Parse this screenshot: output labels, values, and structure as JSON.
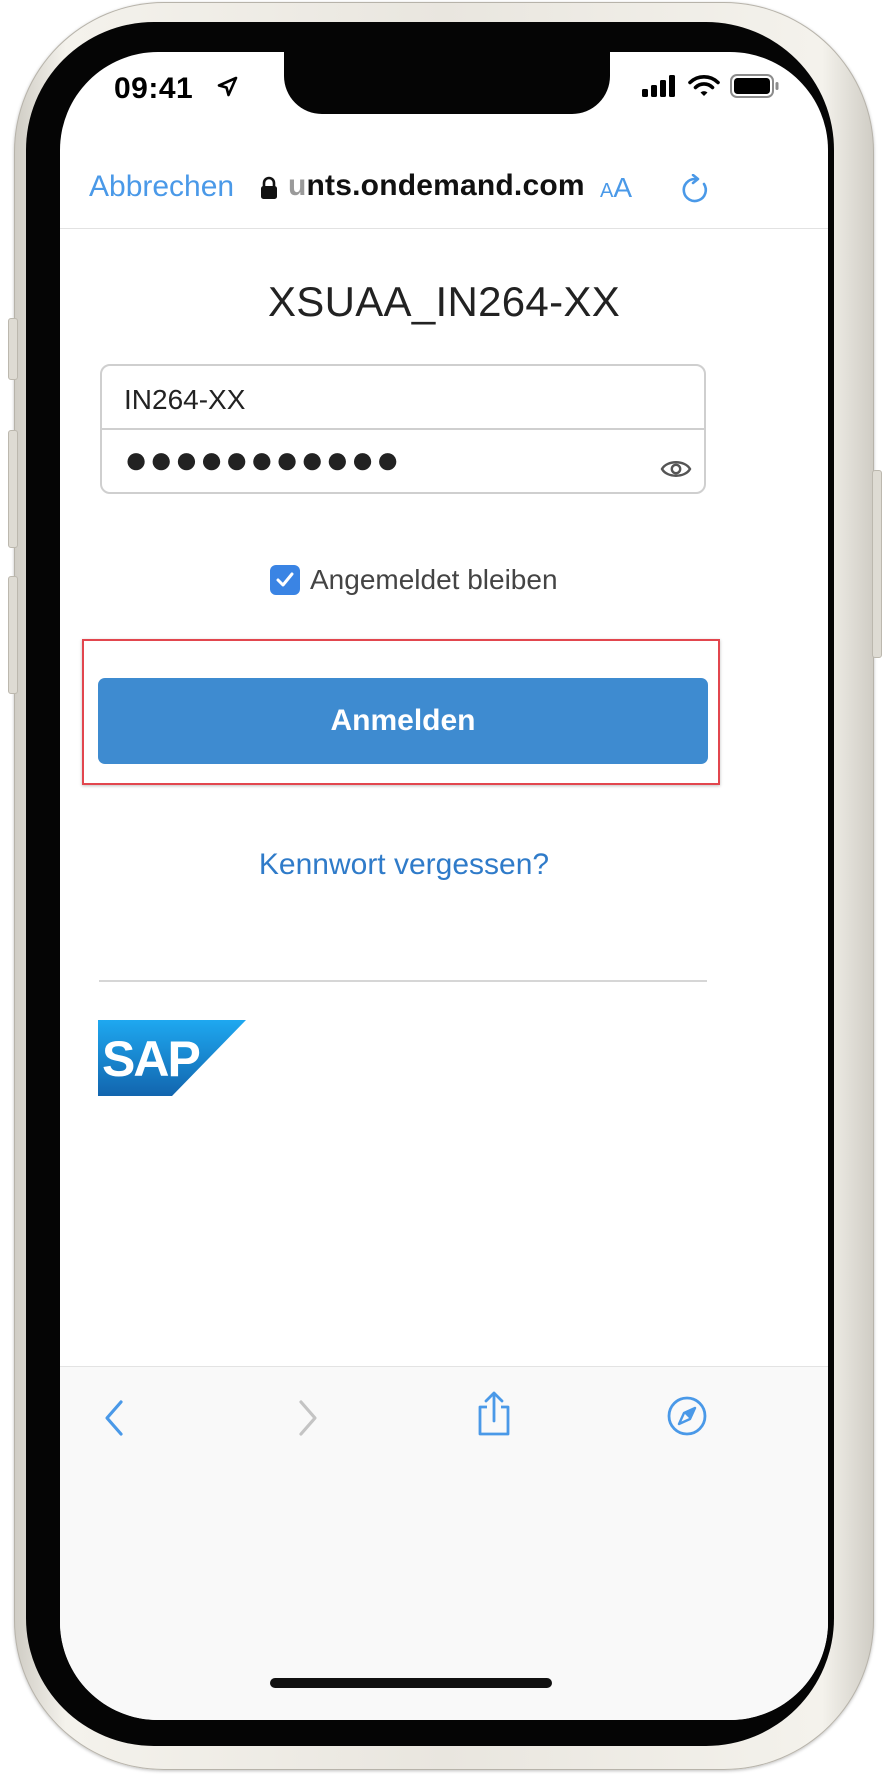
{
  "status_bar": {
    "time": "09:41"
  },
  "browser": {
    "cancel_label": "Abbrechen",
    "url_faded": "u",
    "url": "nts.ondemand.com",
    "text_size_small": "A",
    "text_size_big": "A"
  },
  "login": {
    "title": "XSUAA_IN264-XX",
    "username_value": "IN264-XX",
    "password_value": "●●●●●●●●●●●",
    "remember_label": "Angemeldet bleiben",
    "remember_checked": true,
    "submit_label": "Anmelden",
    "forgot_label": "Kennwort vergessen?"
  },
  "branding": {
    "logo_text": "SAP"
  },
  "colors": {
    "accent_blue": "#4a99e8",
    "button_blue": "#3e8bd0",
    "highlight_red": "#e2464e"
  },
  "toolbar": {
    "icons": [
      "back-icon",
      "forward-icon",
      "share-icon",
      "compass-icon"
    ]
  }
}
